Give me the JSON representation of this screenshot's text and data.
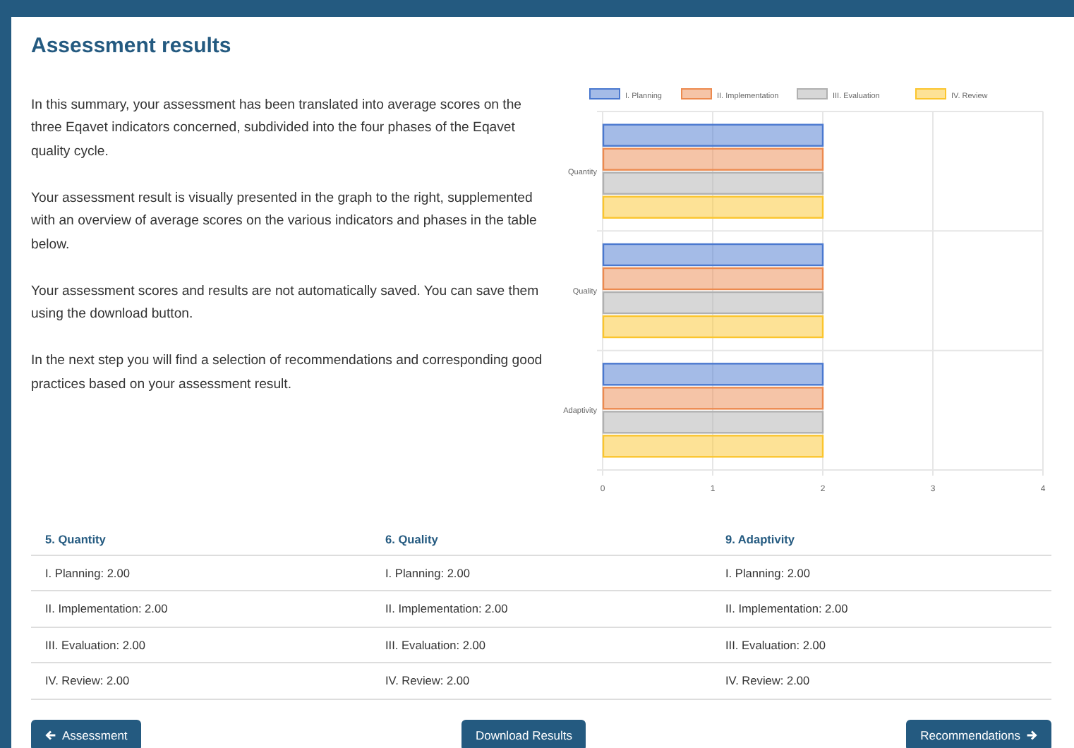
{
  "title": "Assessment results",
  "paragraphs": [
    "In this summary, your assessment has been translated into average scores on the three Eqavet indicators concerned, subdivided into the four phases of the Eqavet quality cycle.",
    "Your assessment result is visually presented in the graph to the right, supplemented with an overview of average scores on the various indicators and phases in the table below.",
    "Your assessment scores and results are not automatically saved. You can save them using the download button.",
    "In the next step you will find a selection of recommendations and corresponding good practices based on your assessment result."
  ],
  "chart_data": {
    "type": "bar",
    "orientation": "horizontal",
    "categories": [
      "Quantity",
      "Quality",
      "Adaptivity"
    ],
    "series": [
      {
        "name": "I. Planning",
        "color": "#4a78cf",
        "values": [
          2,
          2,
          2
        ]
      },
      {
        "name": "II. Implementation",
        "color": "#ec8a4f",
        "values": [
          2,
          2,
          2
        ]
      },
      {
        "name": "III. Evaluation",
        "color": "#b0b0b0",
        "values": [
          2,
          2,
          2
        ]
      },
      {
        "name": "IV. Review",
        "color": "#fbc52d",
        "values": [
          2,
          2,
          2
        ]
      }
    ],
    "xlim": [
      0,
      4
    ],
    "xticks": [
      0,
      1,
      2,
      3,
      4
    ],
    "grid": true,
    "legend": true
  },
  "table": {
    "columns": [
      "5. Quantity",
      "6. Quality",
      "9. Adaptivity"
    ],
    "rows": [
      [
        "I. Planning: 2.00",
        "I. Planning: 2.00",
        "I. Planning: 2.00"
      ],
      [
        "II. Implementation: 2.00",
        "II. Implementation: 2.00",
        "II. Implementation: 2.00"
      ],
      [
        "III. Evaluation: 2.00",
        "III. Evaluation: 2.00",
        "III. Evaluation: 2.00"
      ],
      [
        "IV. Review: 2.00",
        "IV. Review: 2.00",
        "IV. Review: 2.00"
      ]
    ]
  },
  "buttons": [
    {
      "label": "Assessment",
      "kind": "back"
    },
    {
      "label": "Download Results",
      "kind": "plain"
    },
    {
      "label": "Recommendations",
      "kind": "next"
    }
  ]
}
